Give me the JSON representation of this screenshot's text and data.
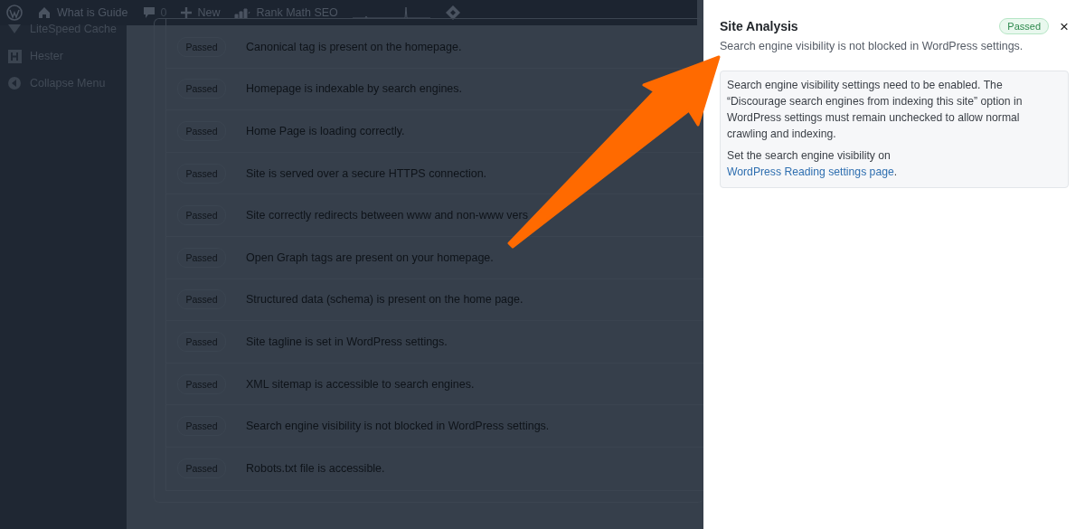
{
  "admin_bar": {
    "site": "What is Guide",
    "comments": "0",
    "new": "New",
    "seo": "Rank Math SEO"
  },
  "sidebar": {
    "items": [
      {
        "label": "LiteSpeed Cache"
      },
      {
        "label": "Hester"
      },
      {
        "label": "Collapse Menu"
      }
    ]
  },
  "checks": [
    {
      "status": "Passed",
      "text": "Canonical tag is present on the homepage."
    },
    {
      "status": "Passed",
      "text": "Homepage is indexable by search engines."
    },
    {
      "status": "Passed",
      "text": "Home Page is loading correctly."
    },
    {
      "status": "Passed",
      "text": "Site is served over a secure HTTPS connection."
    },
    {
      "status": "Passed",
      "text": "Site correctly redirects between www and non-www vers"
    },
    {
      "status": "Passed",
      "text": "Open Graph tags are present on your homepage."
    },
    {
      "status": "Passed",
      "text": "Structured data (schema) is present on the home page."
    },
    {
      "status": "Passed",
      "text": "Site tagline is set in WordPress settings."
    },
    {
      "status": "Passed",
      "text": "XML sitemap is accessible to search engines."
    },
    {
      "status": "Passed",
      "text": "Search engine visibility is not blocked in WordPress settings."
    },
    {
      "status": "Passed",
      "text": "Robots.txt file is accessible."
    }
  ],
  "panel": {
    "title": "Site Analysis",
    "status": "Passed",
    "close": "×",
    "subtitle": "Search engine visibility is not blocked in WordPress settings.",
    "description": "Search engine visibility settings need to be enabled. The “Discourage search engines from indexing this site” option in WordPress settings must remain unchecked to allow normal crawling and indexing.",
    "hint": "Set the search engine visibility on ",
    "link": "WordPress Reading settings page",
    "hint_end": "."
  }
}
